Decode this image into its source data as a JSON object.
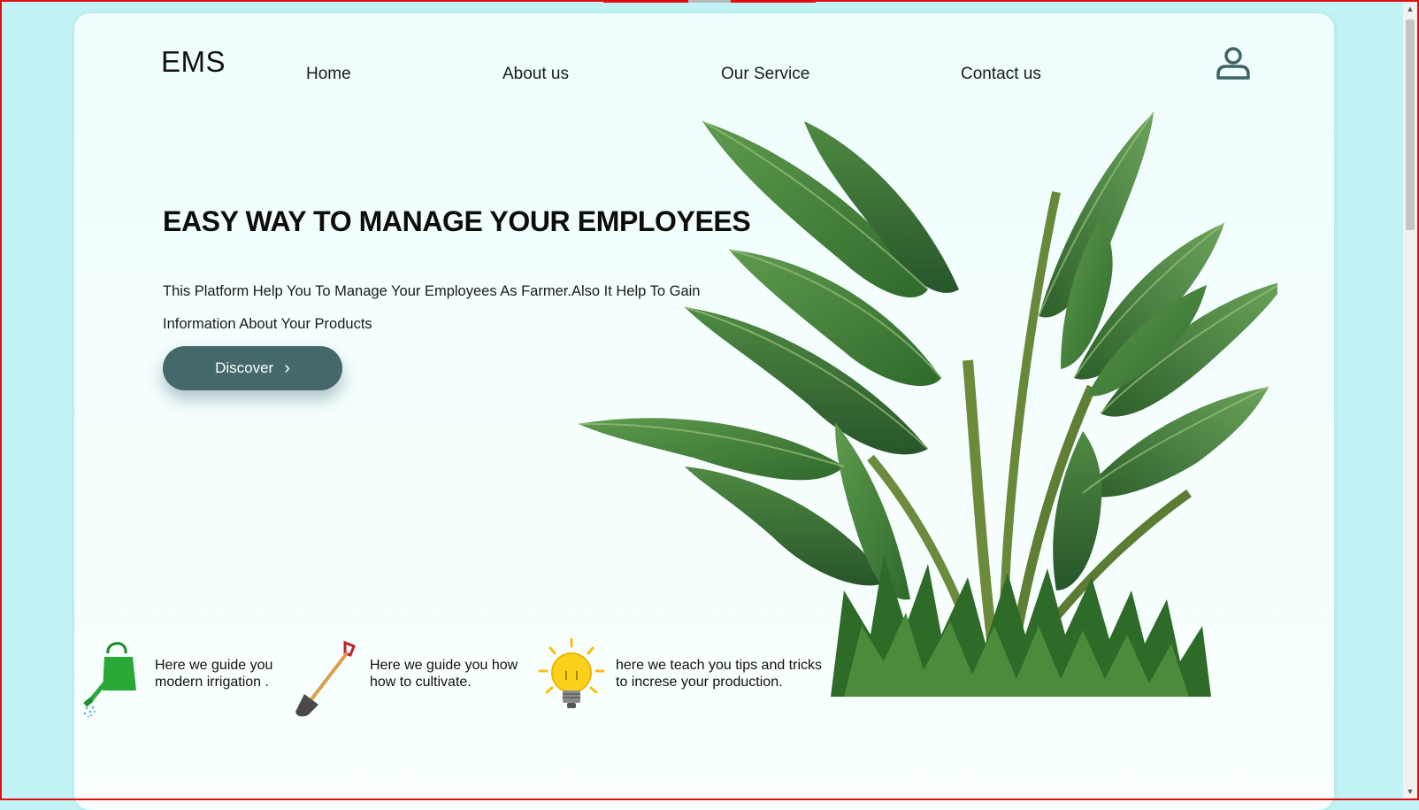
{
  "header": {
    "logo": "EMS",
    "nav": [
      {
        "label": "Home"
      },
      {
        "label": "About us"
      },
      {
        "label": "Our Service"
      },
      {
        "label": "Contact us"
      }
    ],
    "user_icon": "user-icon"
  },
  "hero": {
    "title": "EASY WAY TO MANAGE YOUR EMPLOYEES",
    "description_line1": "This Platform Help You To Manage Your Employees As Farmer.Also It Help To Gain",
    "description_line2": "Information About Your Products",
    "cta_label": "Discover",
    "cta_icon": "chevron-right-icon",
    "image": "banana-plant"
  },
  "features": [
    {
      "icon": "watering-can-icon",
      "line1": "Here we guide you",
      "line2": "modern irrigation ."
    },
    {
      "icon": "shovel-icon",
      "line1": "Here we guide you how",
      "line2": "how to cultivate."
    },
    {
      "icon": "light-bulb-icon",
      "line1": "here we teach you tips and tricks",
      "line2": "to increse your production."
    }
  ],
  "colors": {
    "accent": "#45686b",
    "background": "#c2f2f5",
    "card": "#f4fefe",
    "leaf": "#3d7a35"
  }
}
